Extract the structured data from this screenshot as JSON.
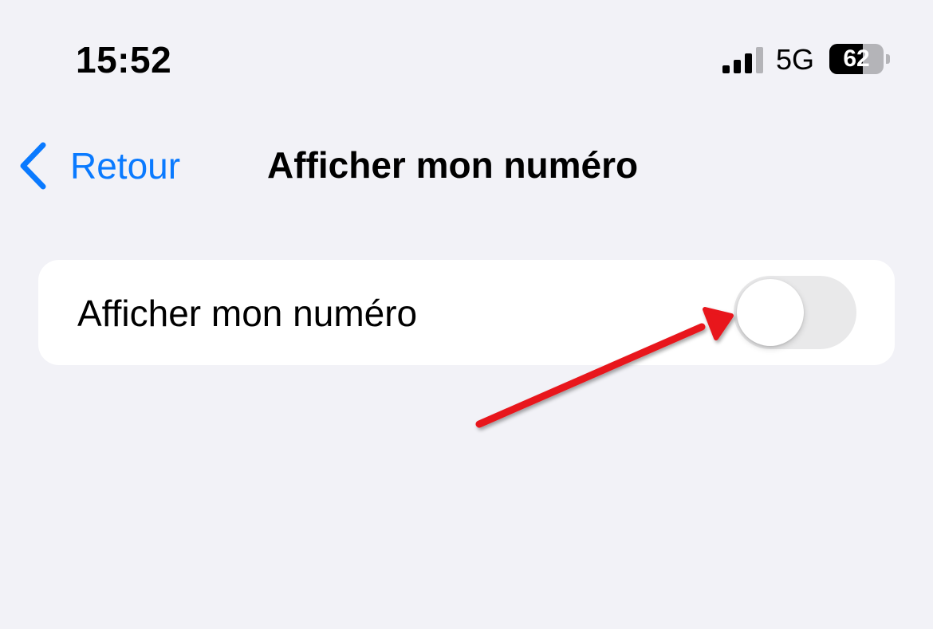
{
  "status_bar": {
    "time": "15:52",
    "network": "5G",
    "battery_level": "62",
    "battery_fraction": 0.62,
    "signal_icon": "cellular-signal-icon",
    "battery_icon": "battery-icon"
  },
  "nav": {
    "back_label": "Retour",
    "back_icon": "chevron-left-icon",
    "title": "Afficher mon numéro"
  },
  "settings": {
    "rows": [
      {
        "label": "Afficher mon numéro",
        "toggle_on": false
      }
    ]
  },
  "colors": {
    "accent": "#0a7aff",
    "background": "#f2f2f7",
    "toggle_off": "#e9e9ea",
    "annotation_arrow": "#e8141a"
  }
}
